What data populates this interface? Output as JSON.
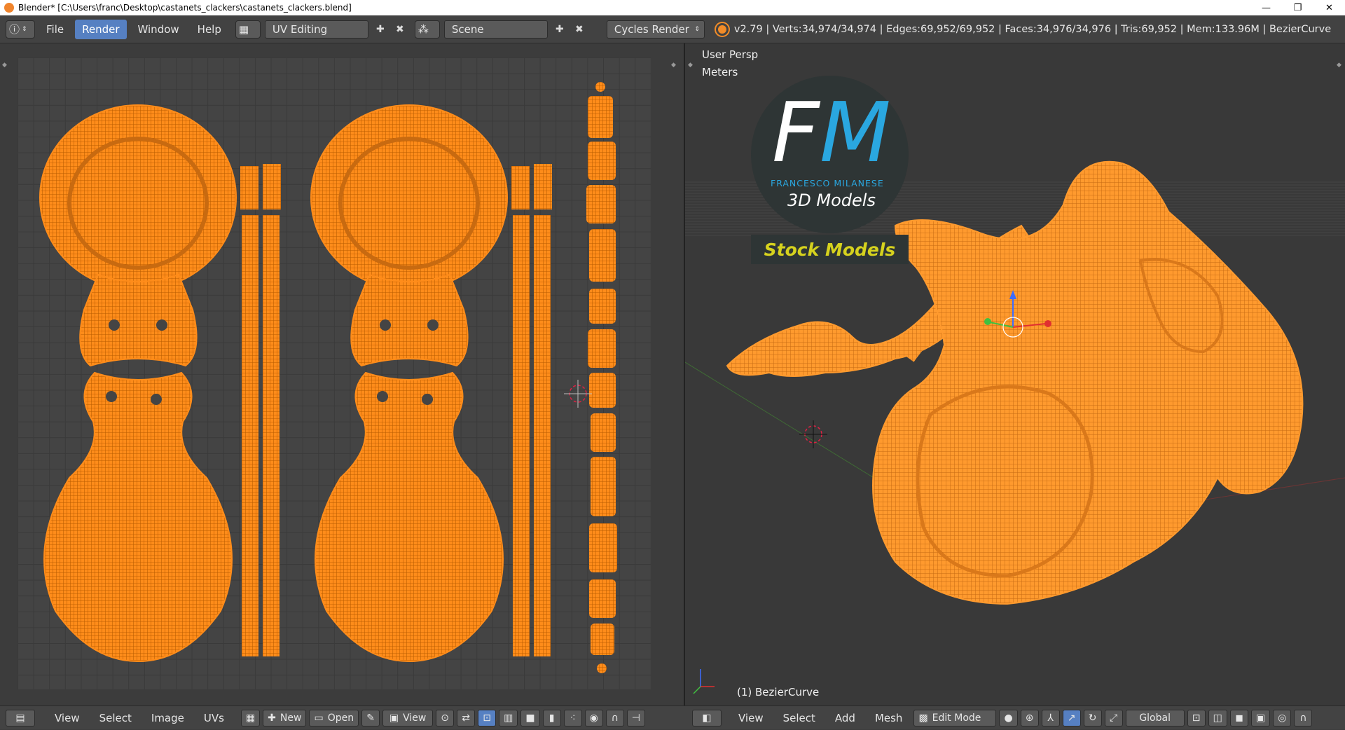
{
  "window": {
    "title": "Blender* [C:\\Users\\franc\\Desktop\\castanets_clackers\\castanets_clackers.blend]",
    "controls": [
      "—",
      "❐",
      "✕"
    ]
  },
  "topbar": {
    "menus": [
      "File",
      "Render",
      "Window",
      "Help"
    ],
    "active_menu": "Render",
    "screen_layout": "UV Editing",
    "scene": "Scene",
    "render_engine": "Cycles Render",
    "stats": "v2.79 | Verts:34,974/34,974 | Edges:69,952/69,952 | Faces:34,976/34,976 | Tris:69,952 | Mem:133.96M | BezierCurve"
  },
  "viewport": {
    "view_name": "User Persp",
    "units": "Meters",
    "object_label": "(1) BezierCurve"
  },
  "watermark": {
    "letters_f": "F",
    "letters_m": "M",
    "brand": "FRANCESCO MILANESE",
    "subtitle": "3D Models",
    "tag": "Stock Models"
  },
  "uv_bottom": {
    "menus": [
      "View",
      "Select",
      "Image",
      "UVs"
    ],
    "new_label": "New",
    "open_label": "Open",
    "view_label": "View"
  },
  "view3d_bottom": {
    "menus": [
      "View",
      "Select",
      "Add",
      "Mesh"
    ],
    "mode": "Edit Mode",
    "orientation": "Global"
  },
  "colors": {
    "mesh": "#ff8c1a",
    "accent": "#5680c2",
    "logo_blue": "#2aa7e0",
    "stock_yellow": "#d6d21e"
  }
}
